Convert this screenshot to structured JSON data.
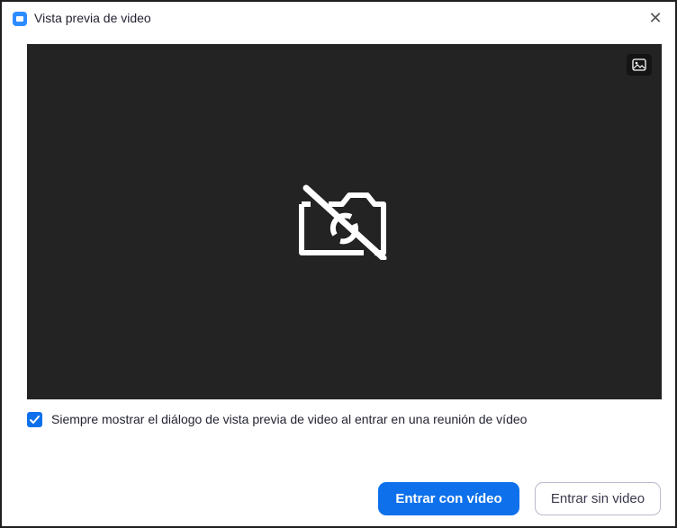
{
  "window": {
    "title": "Vista previa de video",
    "close_glyph": "✕"
  },
  "video_preview": {
    "state": "camera-off",
    "icons": [
      "camera-off-icon",
      "background-image-icon"
    ],
    "colors": {
      "background": "#232323",
      "icon": "#ffffff"
    }
  },
  "checkbox": {
    "checked": true,
    "label": "Siempre mostrar el diálogo de vista previa de video al entrar en una reunión de vídeo"
  },
  "buttons": {
    "join_with_video": "Entrar con vídeo",
    "join_without_video": "Entrar sin video"
  },
  "colors": {
    "accent": "#0e71eb",
    "app_icon": "#2d8cff"
  }
}
